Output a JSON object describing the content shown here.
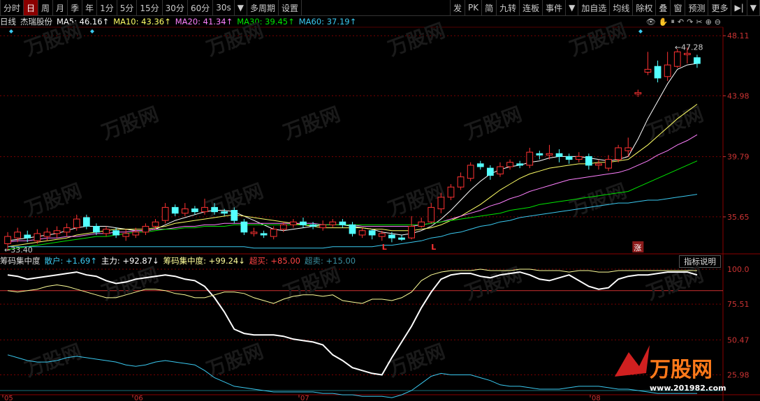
{
  "toolbar": {
    "left": [
      "分时",
      "日",
      "周",
      "月",
      "季",
      "年",
      "1分",
      "5分",
      "15分",
      "30分",
      "60分",
      "30s",
      "▼",
      "多周期",
      "设置"
    ],
    "active_index": 1,
    "right": [
      "发",
      "PK",
      "简",
      "九转",
      "连板",
      "事件",
      "▼",
      "加自选",
      "均线",
      "除权",
      "叠",
      "窗",
      "预测",
      "更多",
      "▶|",
      "▼"
    ]
  },
  "info": {
    "period": "日线",
    "stock": "杰瑞股份",
    "ma5": "MA5: 46.16↑",
    "ma10": "MA10: 43.36↑",
    "ma20": "MA20: 41.34↑",
    "ma30": "MA30: 39.45↑",
    "ma60": "MA60: 37.19↑"
  },
  "price_axis": [
    "48.11",
    "43.98",
    "39.79",
    "35.65"
  ],
  "price_range": [
    33.2,
    48.6
  ],
  "high_label": "47.28",
  "low_label": "33.40",
  "markers": {
    "l1": "L",
    "l2": "L",
    "zhang": "涨"
  },
  "indicator": {
    "name": "筹码集中度",
    "sanhu": "散户: +1.69↑",
    "zhuli": "主力: +92.87↓",
    "chouma": "筹码集中度: +99.24↓",
    "chaomai": "超买: +85.00",
    "chaomai2": "超卖: +15.00",
    "help": "指标说明",
    "axis": [
      "100.0",
      "75.51",
      "50.47",
      "25.98"
    ]
  },
  "dates": [
    "05",
    "06",
    "07",
    "08"
  ],
  "watermark": "万股网",
  "watermark_url": "www.201982.com",
  "colors": {
    "up": "#ff3232",
    "down": "#54ffff",
    "ma5": "#ffffff",
    "ma10": "#ffff66",
    "ma20": "#ff80ff",
    "ma30": "#00e600",
    "ma60": "#3ac9f0",
    "grid": "#7a0000"
  },
  "chart_data": {
    "type": "candlestick",
    "candles": [
      [
        33.8,
        34.3,
        33.3,
        34.6
      ],
      [
        34.2,
        34.6,
        33.9,
        34.9
      ],
      [
        34.4,
        34.2,
        33.9,
        34.7
      ],
      [
        34.0,
        34.5,
        33.8,
        34.8
      ],
      [
        34.3,
        34.6,
        34.0,
        34.9
      ],
      [
        34.5,
        34.7,
        34.2,
        35.0
      ],
      [
        34.6,
        34.9,
        34.3,
        35.2
      ],
      [
        34.9,
        35.5,
        34.7,
        35.8
      ],
      [
        35.6,
        35.0,
        34.8,
        35.8
      ],
      [
        35.0,
        34.6,
        34.4,
        35.2
      ],
      [
        34.5,
        34.8,
        34.3,
        35.0
      ],
      [
        34.7,
        34.4,
        34.2,
        34.9
      ],
      [
        34.3,
        34.5,
        34.0,
        34.8
      ],
      [
        34.4,
        34.6,
        34.2,
        34.9
      ],
      [
        34.6,
        35.0,
        34.4,
        35.2
      ],
      [
        35.0,
        35.3,
        34.8,
        35.5
      ],
      [
        35.4,
        36.3,
        35.2,
        36.6
      ],
      [
        36.3,
        35.9,
        35.7,
        36.5
      ],
      [
        35.9,
        36.2,
        35.7,
        36.6
      ],
      [
        36.2,
        36.0,
        35.8,
        36.4
      ],
      [
        36.0,
        36.3,
        35.8,
        36.9
      ],
      [
        36.3,
        36.0,
        35.8,
        36.6
      ],
      [
        36.0,
        35.9,
        35.7,
        36.2
      ],
      [
        36.1,
        35.4,
        35.2,
        36.3
      ],
      [
        35.3,
        34.6,
        34.4,
        35.5
      ],
      [
        34.5,
        34.6,
        34.3,
        34.9
      ],
      [
        34.5,
        34.4,
        34.2,
        34.7
      ],
      [
        34.3,
        34.8,
        34.1,
        35.0
      ],
      [
        34.8,
        35.1,
        34.6,
        35.3
      ],
      [
        35.1,
        35.3,
        34.9,
        35.5
      ],
      [
        35.3,
        35.1,
        34.9,
        35.6
      ],
      [
        35.1,
        35.0,
        34.8,
        35.3
      ],
      [
        34.9,
        35.1,
        34.7,
        35.4
      ],
      [
        35.1,
        35.3,
        34.9,
        35.5
      ],
      [
        35.3,
        35.1,
        34.9,
        35.5
      ],
      [
        35.1,
        34.5,
        34.3,
        35.3
      ],
      [
        34.4,
        34.7,
        34.2,
        34.9
      ],
      [
        34.7,
        34.4,
        34.1,
        34.8
      ],
      [
        34.3,
        34.5,
        34.0,
        34.7
      ],
      [
        34.4,
        34.2,
        33.9,
        34.6
      ],
      [
        34.2,
        34.1,
        34.0,
        34.4
      ],
      [
        34.2,
        35.0,
        34.1,
        35.7
      ],
      [
        35.0,
        35.3,
        34.9,
        35.6
      ],
      [
        35.3,
        36.3,
        35.2,
        36.6
      ],
      [
        36.2,
        37.0,
        35.9,
        37.3
      ],
      [
        37.0,
        37.7,
        36.8,
        37.9
      ],
      [
        37.7,
        38.4,
        37.5,
        38.7
      ],
      [
        38.3,
        39.2,
        38.1,
        39.4
      ],
      [
        39.3,
        39.1,
        38.9,
        39.5
      ],
      [
        39.0,
        38.5,
        38.2,
        39.2
      ],
      [
        38.6,
        39.1,
        38.4,
        39.4
      ],
      [
        39.1,
        39.4,
        38.9,
        39.6
      ],
      [
        39.3,
        39.2,
        39.0,
        39.5
      ],
      [
        39.2,
        40.1,
        39.0,
        40.4
      ],
      [
        40.0,
        39.9,
        39.6,
        40.2
      ],
      [
        39.9,
        40.0,
        39.6,
        40.6
      ],
      [
        40.0,
        39.8,
        39.4,
        40.3
      ],
      [
        39.8,
        39.6,
        39.3,
        40.0
      ],
      [
        39.6,
        39.8,
        39.4,
        40.1
      ],
      [
        39.8,
        39.2,
        38.9,
        40.0
      ],
      [
        39.2,
        39.3,
        38.9,
        39.6
      ],
      [
        39.0,
        39.6,
        38.8,
        39.9
      ],
      [
        39.6,
        40.4,
        39.4,
        40.6
      ],
      [
        40.2,
        40.4,
        39.8,
        41.1
      ],
      [
        44.1,
        44.2,
        43.9,
        44.4
      ],
      [
        45.6,
        45.8,
        45.4,
        47.0
      ],
      [
        46.0,
        45.2,
        44.9,
        46.4
      ],
      [
        45.3,
        46.1,
        45.0,
        47.0
      ],
      [
        46.0,
        47.0,
        45.9,
        47.2
      ],
      [
        46.8,
        46.9,
        46.2,
        47.3
      ],
      [
        46.6,
        46.2,
        45.9,
        46.8
      ]
    ],
    "ma_series": {
      "MA5": [
        34.0,
        34.1,
        34.2,
        34.3,
        34.4,
        34.5,
        34.7,
        34.9,
        35.0,
        35.0,
        35.0,
        34.9,
        34.8,
        34.7,
        34.7,
        34.8,
        35.1,
        35.4,
        35.6,
        35.8,
        36.0,
        36.1,
        36.1,
        36.0,
        35.7,
        35.4,
        35.1,
        34.8,
        34.7,
        34.8,
        34.9,
        35.0,
        35.1,
        35.1,
        35.1,
        35.0,
        34.9,
        34.8,
        34.6,
        34.5,
        34.4,
        34.5,
        34.7,
        35.0,
        35.5,
        36.1,
        36.8,
        37.5,
        38.1,
        38.6,
        38.9,
        39.1,
        39.2,
        39.4,
        39.5,
        39.7,
        39.8,
        39.8,
        39.8,
        39.7,
        39.6,
        39.5,
        39.6,
        39.8,
        41.0,
        42.4,
        43.6,
        44.8,
        45.8,
        46.1,
        46.2
      ],
      "MA10": [
        33.6,
        33.7,
        33.8,
        33.9,
        34.0,
        34.1,
        34.2,
        34.4,
        34.5,
        34.6,
        34.7,
        34.8,
        34.8,
        34.8,
        34.8,
        34.9,
        35.0,
        35.2,
        35.3,
        35.4,
        35.5,
        35.6,
        35.7,
        35.8,
        35.7,
        35.6,
        35.5,
        35.4,
        35.3,
        35.2,
        35.1,
        35.0,
        34.9,
        34.9,
        34.9,
        34.9,
        34.9,
        34.8,
        34.8,
        34.7,
        34.7,
        34.7,
        34.8,
        34.9,
        35.1,
        35.4,
        35.7,
        36.1,
        36.5,
        37.0,
        37.5,
        37.9,
        38.3,
        38.6,
        38.8,
        39.0,
        39.1,
        39.2,
        39.3,
        39.3,
        39.4,
        39.4,
        39.5,
        39.6,
        40.1,
        40.6,
        41.2,
        41.8,
        42.4,
        42.9,
        43.4
      ],
      "MA20": [
        33.9,
        34.0,
        34.0,
        34.1,
        34.2,
        34.2,
        34.3,
        34.3,
        34.4,
        34.5,
        34.5,
        34.6,
        34.6,
        34.7,
        34.7,
        34.8,
        34.8,
        34.9,
        35.0,
        35.0,
        35.1,
        35.1,
        35.2,
        35.2,
        35.2,
        35.2,
        35.2,
        35.2,
        35.2,
        35.2,
        35.2,
        35.2,
        35.1,
        35.1,
        35.1,
        35.1,
        35.0,
        35.0,
        35.0,
        35.0,
        35.0,
        35.0,
        35.1,
        35.2,
        35.3,
        35.5,
        35.7,
        35.9,
        36.1,
        36.4,
        36.6,
        36.9,
        37.1,
        37.4,
        37.6,
        37.8,
        38.0,
        38.2,
        38.3,
        38.4,
        38.5,
        38.6,
        38.7,
        38.9,
        39.2,
        39.5,
        39.9,
        40.2,
        40.6,
        40.9,
        41.3
      ],
      "MA30": [
        33.4,
        33.5,
        33.6,
        33.7,
        33.8,
        33.9,
        34.0,
        34.1,
        34.2,
        34.3,
        34.3,
        34.4,
        34.5,
        34.6,
        34.6,
        34.7,
        34.8,
        34.8,
        34.9,
        34.9,
        35.0,
        35.0,
        35.0,
        35.1,
        35.1,
        35.1,
        35.1,
        35.1,
        35.1,
        35.1,
        35.1,
        35.1,
        35.1,
        35.1,
        35.1,
        35.1,
        35.1,
        35.1,
        35.1,
        35.1,
        35.1,
        35.1,
        35.1,
        35.2,
        35.3,
        35.4,
        35.5,
        35.6,
        35.7,
        35.8,
        35.9,
        36.1,
        36.2,
        36.3,
        36.5,
        36.6,
        36.7,
        36.8,
        36.9,
        37.0,
        37.1,
        37.2,
        37.3,
        37.4,
        37.7,
        38.0,
        38.3,
        38.6,
        38.9,
        39.2,
        39.5
      ],
      "MA60": [
        33.6,
        33.6,
        33.6,
        33.6,
        33.6,
        33.6,
        33.6,
        33.6,
        33.6,
        33.6,
        33.6,
        33.6,
        33.6,
        33.6,
        33.6,
        33.6,
        33.6,
        33.6,
        33.6,
        33.6,
        33.6,
        33.6,
        33.6,
        33.6,
        33.6,
        33.5,
        33.5,
        33.5,
        33.5,
        33.5,
        33.5,
        33.5,
        33.5,
        33.6,
        33.6,
        33.6,
        33.6,
        33.6,
        33.7,
        33.7,
        33.8,
        33.9,
        34.0,
        34.2,
        34.3,
        34.5,
        34.6,
        34.8,
        35.0,
        35.1,
        35.3,
        35.4,
        35.6,
        35.7,
        35.8,
        35.9,
        36.0,
        36.1,
        36.2,
        36.3,
        36.4,
        36.5,
        36.6,
        36.6,
        36.7,
        36.8,
        36.8,
        36.9,
        37.0,
        37.1,
        37.2
      ]
    },
    "indicator_series": {
      "主力": [
        96,
        95,
        93,
        94,
        95,
        96,
        97,
        98,
        96,
        95,
        92,
        90,
        91,
        93,
        94,
        95,
        96,
        95,
        93,
        92,
        88,
        80,
        70,
        58,
        55,
        54,
        54,
        54,
        53,
        51,
        50,
        49,
        47,
        40,
        36,
        31,
        29,
        27,
        26,
        38,
        49,
        60,
        73,
        84,
        93,
        96,
        97,
        97,
        95,
        94,
        96,
        97,
        98,
        96,
        93,
        92,
        94,
        96,
        92,
        88,
        86,
        87,
        93,
        95,
        96,
        96,
        97,
        98,
        98,
        98,
        96
      ],
      "散户": [
        40,
        38,
        36,
        35,
        35,
        36,
        38,
        39,
        38,
        37,
        36,
        35,
        33,
        32,
        33,
        35,
        36,
        35,
        34,
        33,
        29,
        24,
        21,
        18,
        17,
        16,
        15,
        14,
        14,
        14,
        14,
        14,
        13,
        13,
        12,
        12,
        11,
        11,
        11,
        10,
        12,
        15,
        20,
        25,
        27,
        26,
        26,
        26,
        24,
        22,
        19,
        18,
        18,
        17,
        16,
        16,
        16,
        17,
        18,
        18,
        18,
        17,
        16,
        16,
        15,
        14,
        13,
        13,
        13,
        13,
        13
      ],
      "筹码集中度": [
        85,
        84,
        85,
        86,
        88,
        89,
        88,
        86,
        84,
        82,
        80,
        80,
        82,
        84,
        86,
        86,
        85,
        83,
        82,
        80,
        80,
        82,
        84,
        84,
        83,
        80,
        78,
        76,
        79,
        81,
        82,
        82,
        81,
        82,
        78,
        77,
        76,
        79,
        79,
        78,
        80,
        84,
        92,
        96,
        98,
        99,
        99,
        99,
        100,
        99,
        99,
        99,
        100,
        100,
        99,
        99,
        99,
        98,
        99,
        99,
        98,
        98,
        99,
        99,
        99,
        99,
        99,
        99,
        99,
        99,
        99
      ]
    },
    "ylim_main": [
      33.2,
      48.6
    ],
    "ylim_indicator": [
      15,
      100
    ]
  }
}
